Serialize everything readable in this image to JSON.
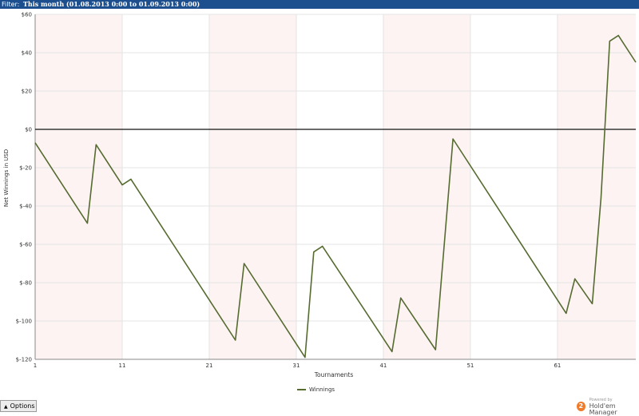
{
  "filter": {
    "label": "Filter:",
    "value": "This month (01.08.2013 0:00 to 01.09.2013 0:00)"
  },
  "chart_data": {
    "type": "line",
    "xlabel": "Tournaments",
    "ylabel": "Net Winnings in USD",
    "xlim": [
      1,
      70
    ],
    "ylim": [
      -120,
      60
    ],
    "x_ticks": [
      "1",
      "11",
      "21",
      "31",
      "41",
      "51",
      "61"
    ],
    "y_ticks": [
      "$60",
      "$40",
      "$20",
      "$0",
      "$-20",
      "$-40",
      "$-60",
      "$-80",
      "$-100",
      "$-120"
    ],
    "grid": true,
    "legend_position": "bottom-center",
    "series": [
      {
        "name": "Winnings",
        "color": "#556b2f",
        "x": [
          1,
          7,
          8,
          11,
          12,
          24,
          25,
          32,
          33,
          34,
          42,
          43,
          47,
          49,
          62,
          63,
          65,
          66,
          67,
          68,
          70
        ],
        "values": [
          -7,
          -49,
          -8,
          -29,
          -26,
          -110,
          -70,
          -119,
          -64,
          -61,
          -116,
          -88,
          -115,
          -5,
          -96,
          -78,
          -91,
          -36,
          46,
          49,
          35
        ]
      }
    ]
  },
  "legend": {
    "label": "Winnings"
  },
  "options_button": {
    "label": "Options"
  },
  "logo": {
    "powered": "Powered by",
    "name": "Hold'em Manager",
    "badge": "2"
  }
}
